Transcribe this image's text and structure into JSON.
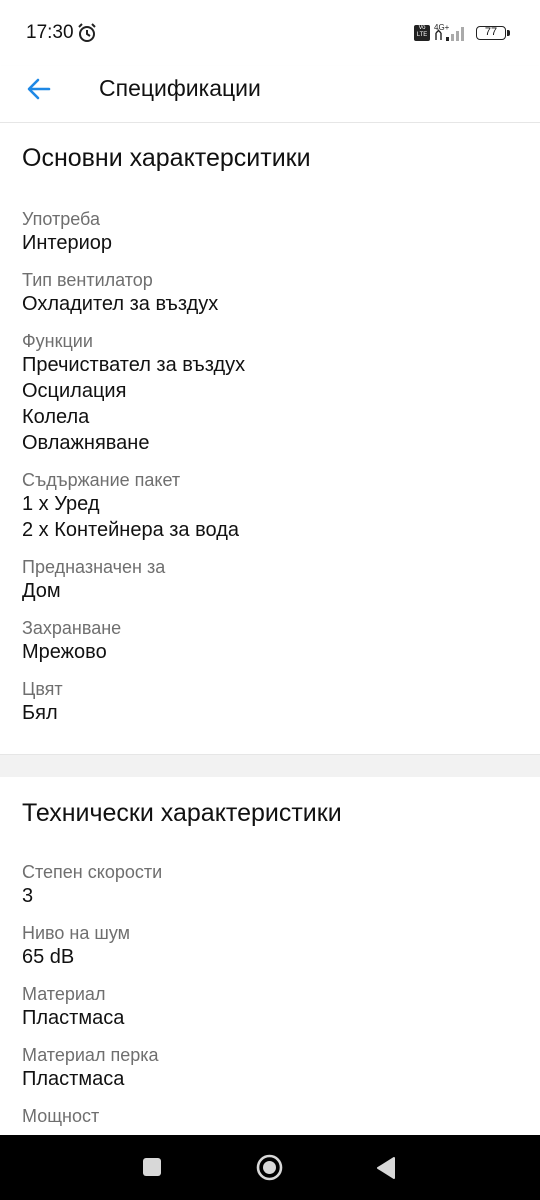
{
  "status_bar": {
    "time": "17:30",
    "volte": "Vo LTE",
    "network": "4G+",
    "battery": "77"
  },
  "app_bar": {
    "title": "Спецификации"
  },
  "sections": [
    {
      "title": "Основни характерситики",
      "specs": [
        {
          "label": "Употреба",
          "values": [
            "Интериор"
          ]
        },
        {
          "label": "Тип вентилатор",
          "values": [
            "Охладител за въздух"
          ]
        },
        {
          "label": "Функции",
          "values": [
            "Пречиствател за въздух",
            "Осцилация",
            "Колела",
            "Овлажняване"
          ]
        },
        {
          "label": "Съдържание пакет",
          "values": [
            "1 x Уред",
            "2 x Контейнера за вода"
          ]
        },
        {
          "label": "Предназначен за",
          "values": [
            "Дом"
          ]
        },
        {
          "label": "Захранване",
          "values": [
            "Мрежово"
          ]
        },
        {
          "label": "Цвят",
          "values": [
            "Бял"
          ]
        }
      ]
    },
    {
      "title": "Технически характеристики",
      "specs": [
        {
          "label": "Степен скорости",
          "values": [
            "3"
          ]
        },
        {
          "label": "Ниво на шум",
          "values": [
            "65 dB"
          ]
        },
        {
          "label": "Материал",
          "values": [
            "Пластмаса"
          ]
        },
        {
          "label": "Материал перка",
          "values": [
            "Пластмаса"
          ]
        },
        {
          "label": "Мощност",
          "values": []
        }
      ]
    }
  ],
  "colors": {
    "accent": "#1e88e5",
    "label_gray": "#6f6f6f",
    "divider": "#f2f2f2"
  }
}
